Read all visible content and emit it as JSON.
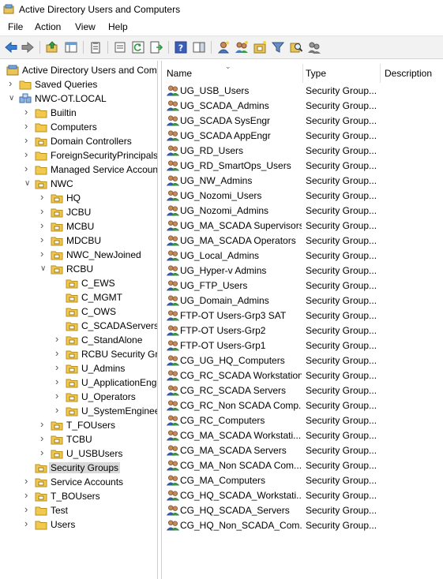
{
  "window": {
    "title": "Active Directory Users and Computers"
  },
  "menu": [
    {
      "label": "File"
    },
    {
      "label": "Action"
    },
    {
      "label": "View"
    },
    {
      "label": "Help"
    }
  ],
  "toolbar": {
    "buttons": [
      {
        "icon": "back-arrow-icon"
      },
      {
        "icon": "forward-arrow-icon"
      },
      {
        "icon": "up-folder-icon"
      },
      {
        "icon": "show-hide-console-tree-icon"
      },
      {
        "icon": "clipboard-icon"
      },
      {
        "icon": "properties-icon"
      },
      {
        "icon": "refresh-icon"
      },
      {
        "icon": "export-list-icon"
      },
      {
        "icon": "help-icon"
      },
      {
        "icon": "action-pane-icon"
      },
      {
        "icon": "create-user-icon"
      },
      {
        "icon": "create-group-icon"
      },
      {
        "icon": "create-ou-icon"
      },
      {
        "icon": "filter-icon"
      },
      {
        "icon": "find-icon"
      },
      {
        "icon": "add-to-group-icon"
      }
    ]
  },
  "tree": {
    "items": [
      {
        "label": "Active Directory Users and Com",
        "level": 0,
        "expander": "none",
        "icon": "snapin"
      },
      {
        "label": "Saved Queries",
        "level": 1,
        "expander": "collapsed",
        "icon": "folder"
      },
      {
        "label": "NWC-OT.LOCAL",
        "level": 1,
        "expander": "expanded",
        "icon": "domain"
      },
      {
        "label": "Builtin",
        "level": 2,
        "expander": "collapsed",
        "icon": "folder"
      },
      {
        "label": "Computers",
        "level": 2,
        "expander": "collapsed",
        "icon": "folder"
      },
      {
        "label": "Domain Controllers",
        "level": 2,
        "expander": "collapsed",
        "icon": "ou"
      },
      {
        "label": "ForeignSecurityPrincipals",
        "level": 2,
        "expander": "collapsed",
        "icon": "folder"
      },
      {
        "label": "Managed Service Account",
        "level": 2,
        "expander": "collapsed",
        "icon": "folder"
      },
      {
        "label": "NWC",
        "level": 2,
        "expander": "expanded",
        "icon": "ou"
      },
      {
        "label": "HQ",
        "level": 3,
        "expander": "collapsed",
        "icon": "ou"
      },
      {
        "label": "JCBU",
        "level": 3,
        "expander": "collapsed",
        "icon": "ou"
      },
      {
        "label": "MCBU",
        "level": 3,
        "expander": "collapsed",
        "icon": "ou"
      },
      {
        "label": "MDCBU",
        "level": 3,
        "expander": "collapsed",
        "icon": "ou"
      },
      {
        "label": "NWC_NewJoined",
        "level": 3,
        "expander": "collapsed",
        "icon": "ou"
      },
      {
        "label": "RCBU",
        "level": 3,
        "expander": "expanded",
        "icon": "ou"
      },
      {
        "label": "C_EWS",
        "level": 4,
        "expander": "none",
        "icon": "ou"
      },
      {
        "label": "C_MGMT",
        "level": 4,
        "expander": "none",
        "icon": "ou"
      },
      {
        "label": "C_OWS",
        "level": 4,
        "expander": "none",
        "icon": "ou"
      },
      {
        "label": "C_SCADAServers",
        "level": 4,
        "expander": "none",
        "icon": "ou"
      },
      {
        "label": "C_StandAlone",
        "level": 4,
        "expander": "collapsed",
        "icon": "ou"
      },
      {
        "label": "RCBU Security Gr",
        "level": 4,
        "expander": "collapsed",
        "icon": "ou"
      },
      {
        "label": "U_Admins",
        "level": 4,
        "expander": "collapsed",
        "icon": "ou"
      },
      {
        "label": "U_ApplicationEng",
        "level": 4,
        "expander": "collapsed",
        "icon": "ou"
      },
      {
        "label": "U_Operators",
        "level": 4,
        "expander": "collapsed",
        "icon": "ou"
      },
      {
        "label": "U_SystemEnginee",
        "level": 4,
        "expander": "collapsed",
        "icon": "ou"
      },
      {
        "label": "T_FOUsers",
        "level": 3,
        "expander": "collapsed",
        "icon": "ou"
      },
      {
        "label": "TCBU",
        "level": 3,
        "expander": "collapsed",
        "icon": "ou"
      },
      {
        "label": "U_USBUsers",
        "level": 3,
        "expander": "collapsed",
        "icon": "ou"
      },
      {
        "label": "Security Groups",
        "level": 2,
        "expander": "none",
        "icon": "ou",
        "selected": true
      },
      {
        "label": "Service Accounts",
        "level": 2,
        "expander": "collapsed",
        "icon": "ou"
      },
      {
        "label": "T_BOUsers",
        "level": 2,
        "expander": "collapsed",
        "icon": "ou"
      },
      {
        "label": "Test",
        "level": 2,
        "expander": "collapsed",
        "icon": "folder"
      },
      {
        "label": "Users",
        "level": 2,
        "expander": "collapsed",
        "icon": "folder"
      }
    ]
  },
  "list": {
    "columns": {
      "name": "Name",
      "type": "Type",
      "description": "Description"
    },
    "rows": [
      {
        "name": "UG_USB_Users",
        "type": "Security Group...",
        "description": ""
      },
      {
        "name": "UG_SCADA_Admins",
        "type": "Security Group...",
        "description": ""
      },
      {
        "name": "UG_SCADA SysEngr",
        "type": "Security Group...",
        "description": ""
      },
      {
        "name": "UG_SCADA AppEngr",
        "type": "Security Group...",
        "description": ""
      },
      {
        "name": "UG_RD_Users",
        "type": "Security Group...",
        "description": ""
      },
      {
        "name": "UG_RD_SmartOps_Users",
        "type": "Security Group...",
        "description": ""
      },
      {
        "name": "UG_NW_Admins",
        "type": "Security Group...",
        "description": ""
      },
      {
        "name": "UG_Nozomi_Users",
        "type": "Security Group...",
        "description": ""
      },
      {
        "name": "UG_Nozomi_Admins",
        "type": "Security Group...",
        "description": ""
      },
      {
        "name": "UG_MA_SCADA Supervisors",
        "type": "Security Group...",
        "description": ""
      },
      {
        "name": "UG_MA_SCADA Operators",
        "type": "Security Group...",
        "description": ""
      },
      {
        "name": "UG_Local_Admins",
        "type": "Security Group...",
        "description": ""
      },
      {
        "name": "UG_Hyper-v Admins",
        "type": "Security Group...",
        "description": ""
      },
      {
        "name": "UG_FTP_Users",
        "type": "Security Group...",
        "description": ""
      },
      {
        "name": "UG_Domain_Admins",
        "type": "Security Group...",
        "description": ""
      },
      {
        "name": "FTP-OT Users-Grp3 SAT",
        "type": "Security Group...",
        "description": ""
      },
      {
        "name": "FTP-OT Users-Grp2",
        "type": "Security Group...",
        "description": ""
      },
      {
        "name": "FTP-OT Users-Grp1",
        "type": "Security Group...",
        "description": ""
      },
      {
        "name": "CG_UG_HQ_Computers",
        "type": "Security Group...",
        "description": ""
      },
      {
        "name": "CG_RC_SCADA Workstations",
        "type": "Security Group...",
        "description": ""
      },
      {
        "name": "CG_RC_SCADA Servers",
        "type": "Security Group...",
        "description": ""
      },
      {
        "name": "CG_RC_Non SCADA Comp...",
        "type": "Security Group...",
        "description": ""
      },
      {
        "name": "CG_RC_Computers",
        "type": "Security Group...",
        "description": ""
      },
      {
        "name": "CG_MA_SCADA Workstati...",
        "type": "Security Group...",
        "description": ""
      },
      {
        "name": "CG_MA_SCADA Servers",
        "type": "Security Group...",
        "description": ""
      },
      {
        "name": "CG_MA_Non SCADA Com...",
        "type": "Security Group...",
        "description": ""
      },
      {
        "name": "CG_MA_Computers",
        "type": "Security Group...",
        "description": ""
      },
      {
        "name": "CG_HQ_SCADA_Workstati...",
        "type": "Security Group...",
        "description": ""
      },
      {
        "name": "CG_HQ_SCADA_Servers",
        "type": "Security Group...",
        "description": ""
      },
      {
        "name": "CG_HQ_Non_SCADA_Com...",
        "type": "Security Group...",
        "description": ""
      }
    ]
  }
}
